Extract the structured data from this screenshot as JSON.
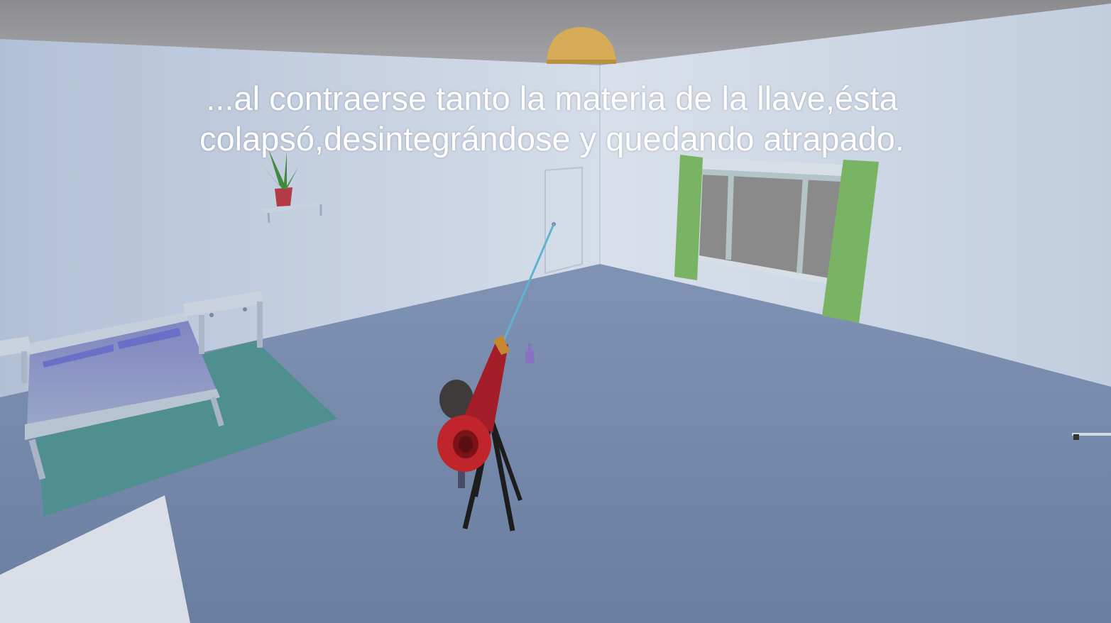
{
  "subtitle": {
    "line1": "...al contraerse tanto la materia de la llave,ésta",
    "line2": "colapsó,desintegrándose y quedando atrapado."
  },
  "colors": {
    "floor": "#6f85a6",
    "back_wall": "#d6dde8",
    "left_wall": "#b8c5d9",
    "right_wall": "#c4cedd",
    "ceiling": "#8e8f92",
    "rug": "#4f8f8f",
    "bed_blanket": "#7f8bb9",
    "pillow": "#6f73c4",
    "curtain": "#76b361",
    "telescope": "#b3222a",
    "beam": "#5fb3d0",
    "lamp": "#d6aa58"
  },
  "icons": {
    "lamp": "ceiling-lamp-icon",
    "plant": "potted-plant-icon",
    "vase": "vase-icon"
  }
}
